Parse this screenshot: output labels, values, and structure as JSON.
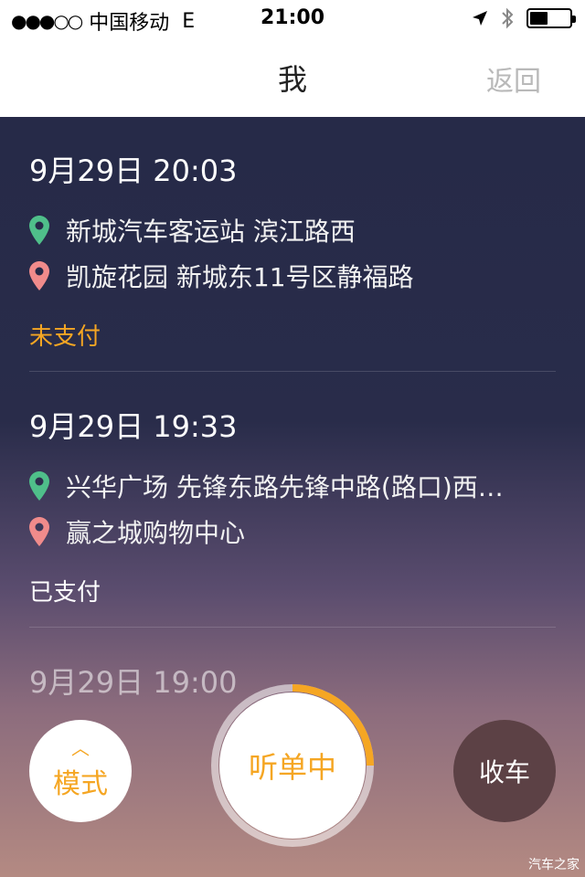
{
  "status_bar": {
    "signal": "●●●○○",
    "carrier": "中国移动",
    "network": "E",
    "time": "21:00",
    "location_icon": "location-arrow-icon",
    "bluetooth_icon": "bluetooth-icon",
    "battery_level": 0.45
  },
  "nav": {
    "title": "我",
    "back_label": "返回"
  },
  "trips": [
    {
      "time": "9月29日 20:03",
      "from": "新城汽车客运站 滨江路西",
      "to": "凯旋花园 新城东11号区静福路",
      "payment": "未支付"
    },
    {
      "time": "9月29日 19:33",
      "from": "兴华广场 先锋东路先锋中路(路口)西…",
      "to": "赢之城购物中心",
      "payment": "已支付"
    },
    {
      "time": "9月29日 19:00"
    }
  ],
  "controls": {
    "mode_label": "模式",
    "mode_chevron": "︿",
    "listen_label": "听单中",
    "listen_progress": 0.25,
    "stop_label": "收车"
  },
  "watermark": "汽车之家",
  "colors": {
    "accent": "#f5a623",
    "origin_pin": "#4fbf8a",
    "destination_pin": "#f08b8b",
    "unpaid": "#f5a623",
    "paid": "#ffffff",
    "stop_button": "#5c4145"
  }
}
